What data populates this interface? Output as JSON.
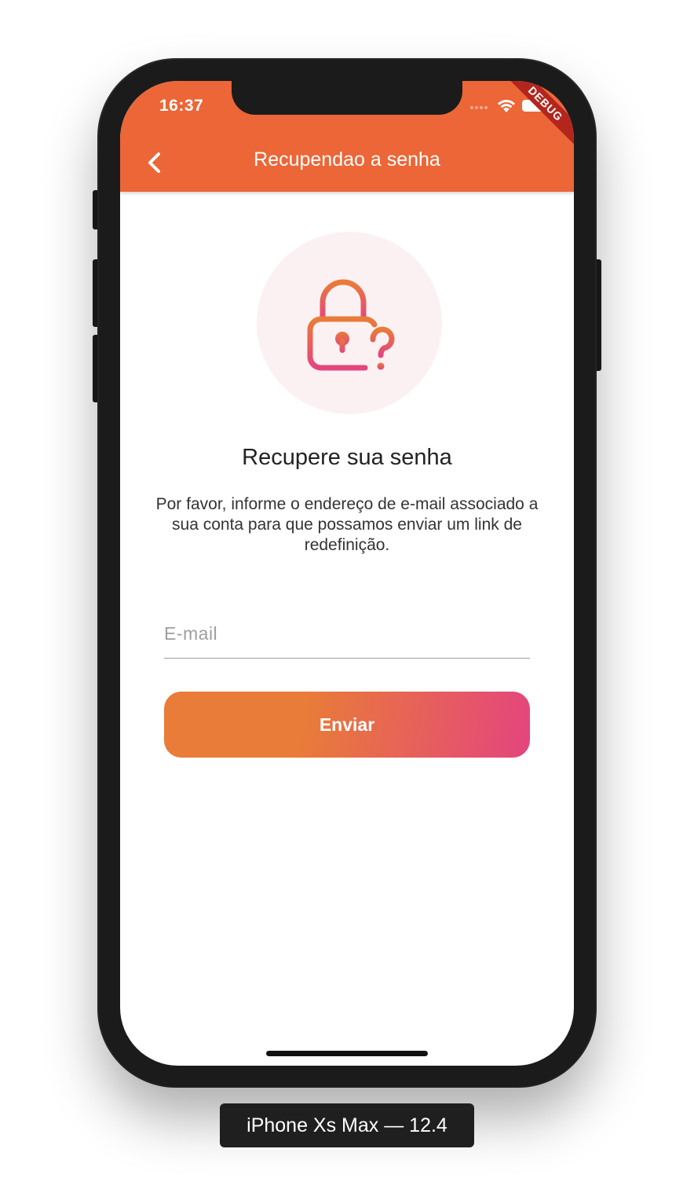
{
  "status_bar": {
    "time": "16:37",
    "debug_banner": "DEBUG"
  },
  "app_bar": {
    "title": "Recupendao a senha",
    "back_icon": "chevron-left-icon",
    "color": "#ec6637"
  },
  "illustration": {
    "icon": "lock-question-icon",
    "gradient": [
      "#e97c38",
      "#e4457e"
    ]
  },
  "content": {
    "heading": "Recupere sua senha",
    "description": "Por favor, informe o endereço de e-mail associado a sua conta para que possamos enviar um link de redefinição.",
    "email_field": {
      "placeholder": "E-mail",
      "value": ""
    },
    "submit_label": "Enviar",
    "button_gradient": [
      "#e97c38",
      "#e4457e"
    ]
  },
  "device": {
    "label": "iPhone Xs Max — 12.4"
  }
}
